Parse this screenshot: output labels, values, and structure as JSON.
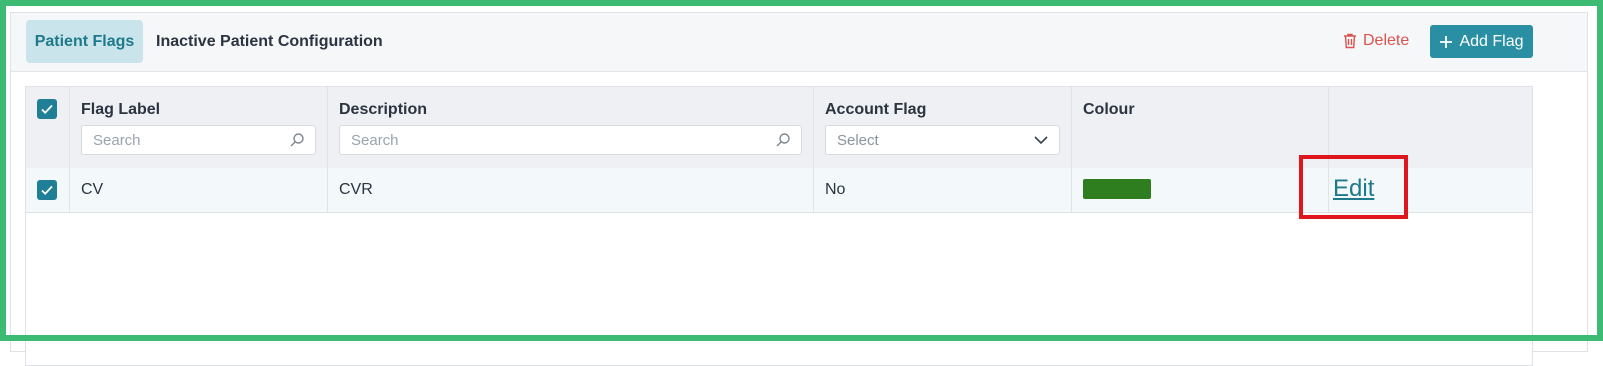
{
  "tabs": [
    {
      "label": "Patient Flags",
      "active": true
    },
    {
      "label": "Inactive Patient Configuration",
      "active": false
    }
  ],
  "toolbar": {
    "delete_label": "Delete",
    "add_label": "Add Flag"
  },
  "table": {
    "columns": [
      {
        "label": "Flag Label",
        "filter_placeholder": "Search",
        "filter_type": "search"
      },
      {
        "label": "Description",
        "filter_placeholder": "Search",
        "filter_type": "search"
      },
      {
        "label": "Account Flag",
        "filter_placeholder": "Select",
        "filter_type": "select"
      },
      {
        "label": "Colour"
      }
    ],
    "header_checkbox_checked": true,
    "rows": [
      {
        "checked": true,
        "flag_label": "CV",
        "description": "CVR",
        "account_flag": "No",
        "colour": "#2e7d1e",
        "action_label": "Edit"
      }
    ]
  },
  "colors": {
    "accent": "#2a8fa3",
    "active_tab_bg": "#c9e4ea",
    "delete": "#d9534f",
    "frame": "#3dba74",
    "highlight": "#e0161e"
  }
}
